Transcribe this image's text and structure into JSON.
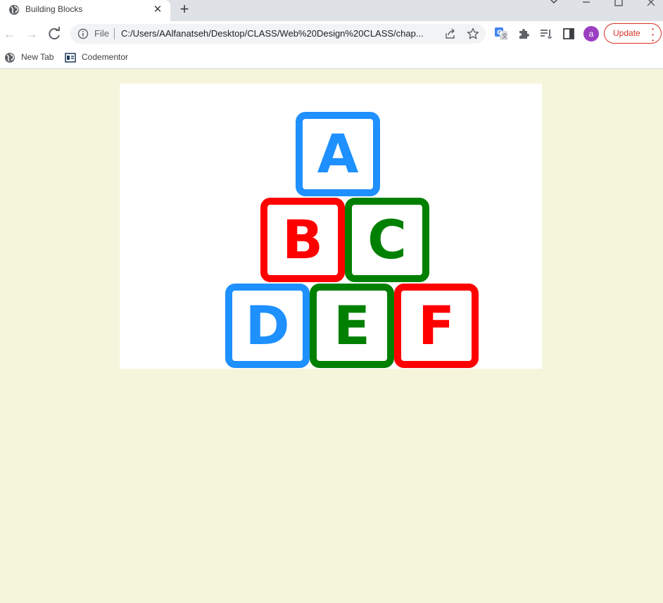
{
  "browser": {
    "tab": {
      "title": "Building Blocks"
    },
    "address": {
      "scheme_label": "File",
      "url": "C:/Users/AAlfanatseh/Desktop/CLASS/Web%20Design%20CLASS/chap..."
    },
    "profile_initial": "a",
    "update_label": "Update"
  },
  "bookmarks": [
    {
      "label": "New Tab"
    },
    {
      "label": "Codementor"
    }
  ],
  "blocks": [
    {
      "letter": "A",
      "color": "#1e90ff"
    },
    {
      "letter": "B",
      "color": "#ff0000"
    },
    {
      "letter": "C",
      "color": "#008000"
    },
    {
      "letter": "D",
      "color": "#1e90ff"
    },
    {
      "letter": "E",
      "color": "#008000"
    },
    {
      "letter": "F",
      "color": "#ff0000"
    }
  ],
  "colors": {
    "page_background": "#f5f5dc",
    "canvas_background": "#ffffff",
    "update_accent": "#d93025",
    "avatar": "#9b3fc1"
  }
}
